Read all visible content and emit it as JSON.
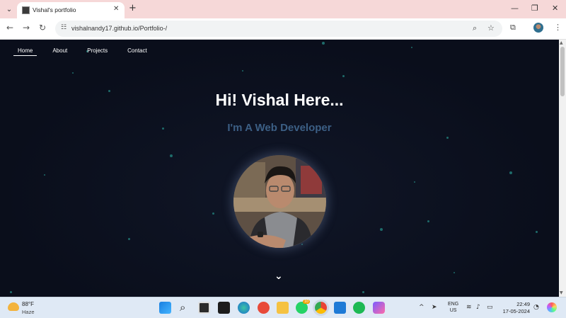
{
  "browser": {
    "tab_title": "Vishal's portfolio",
    "tab_close": "✕",
    "new_tab": "+",
    "url": "vishalnandy17.github.io/Portfolio-/",
    "window_controls": {
      "minimize": "—",
      "restore": "❐",
      "close": "✕"
    }
  },
  "page": {
    "nav": [
      {
        "label": "Home",
        "active": true
      },
      {
        "label": "About",
        "active": false
      },
      {
        "label": "Projects",
        "active": false
      },
      {
        "label": "Contact",
        "active": false
      }
    ],
    "hero_title": "Hi! Vishal Here...",
    "hero_subtitle": "I'm A Web Developer",
    "scroll_down_icon": "chevron-down-icon"
  },
  "taskbar": {
    "weather_temp": "88°F",
    "weather_desc": "Haze",
    "language_line1": "ENG",
    "language_line2": "US",
    "time": "22:49",
    "date": "17-05-2024",
    "whatsapp_badge": "10"
  },
  "colors": {
    "page_background": "#0b0f1e",
    "hero_subtitle": "#3c5f85",
    "particle": "#1e6b6a",
    "tab_strip": "#f6d8d8"
  }
}
